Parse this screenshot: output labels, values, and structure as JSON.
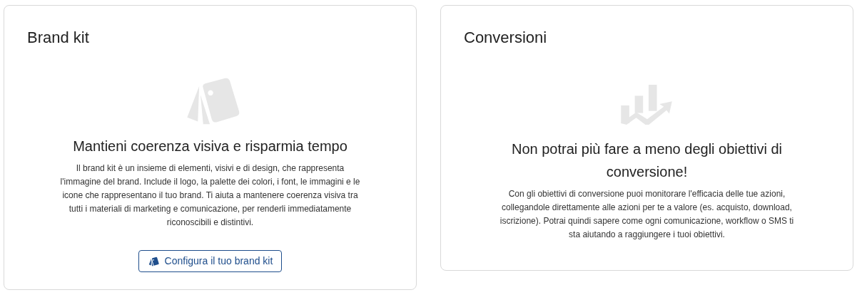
{
  "cards": [
    {
      "title": "Brand kit",
      "kind": "brand",
      "heading": "Mantieni coerenza visiva e risparmia tempo",
      "description": "Il brand kit è un insieme di elementi, visivi e di design, che rappresenta l'immagine del brand. Include il logo, la palette dei colori, i font, le immagini e le icone che rappresentano il tuo brand. Ti aiuta a mantenere coerenza visiva tra tutti i materiali di marketing e comunicazione, per renderli immediatamente riconoscibili e distintivi.",
      "button": "Configura il tuo brand kit"
    },
    {
      "title": "Conversioni",
      "kind": "goals",
      "heading": "Non potrai più fare a meno degli obiettivi di conversione!",
      "description": "Con gli obiettivi di conversione puoi monitorare l'efficacia delle tue azioni, collegandole direttamente alle azioni per te a valore (es. acquisto, download, iscrizione). Potrai quindi sapere come ogni comunicazione, workflow o SMS ti sta aiutando a raggiungere i tuoi obiettivi."
    }
  ]
}
